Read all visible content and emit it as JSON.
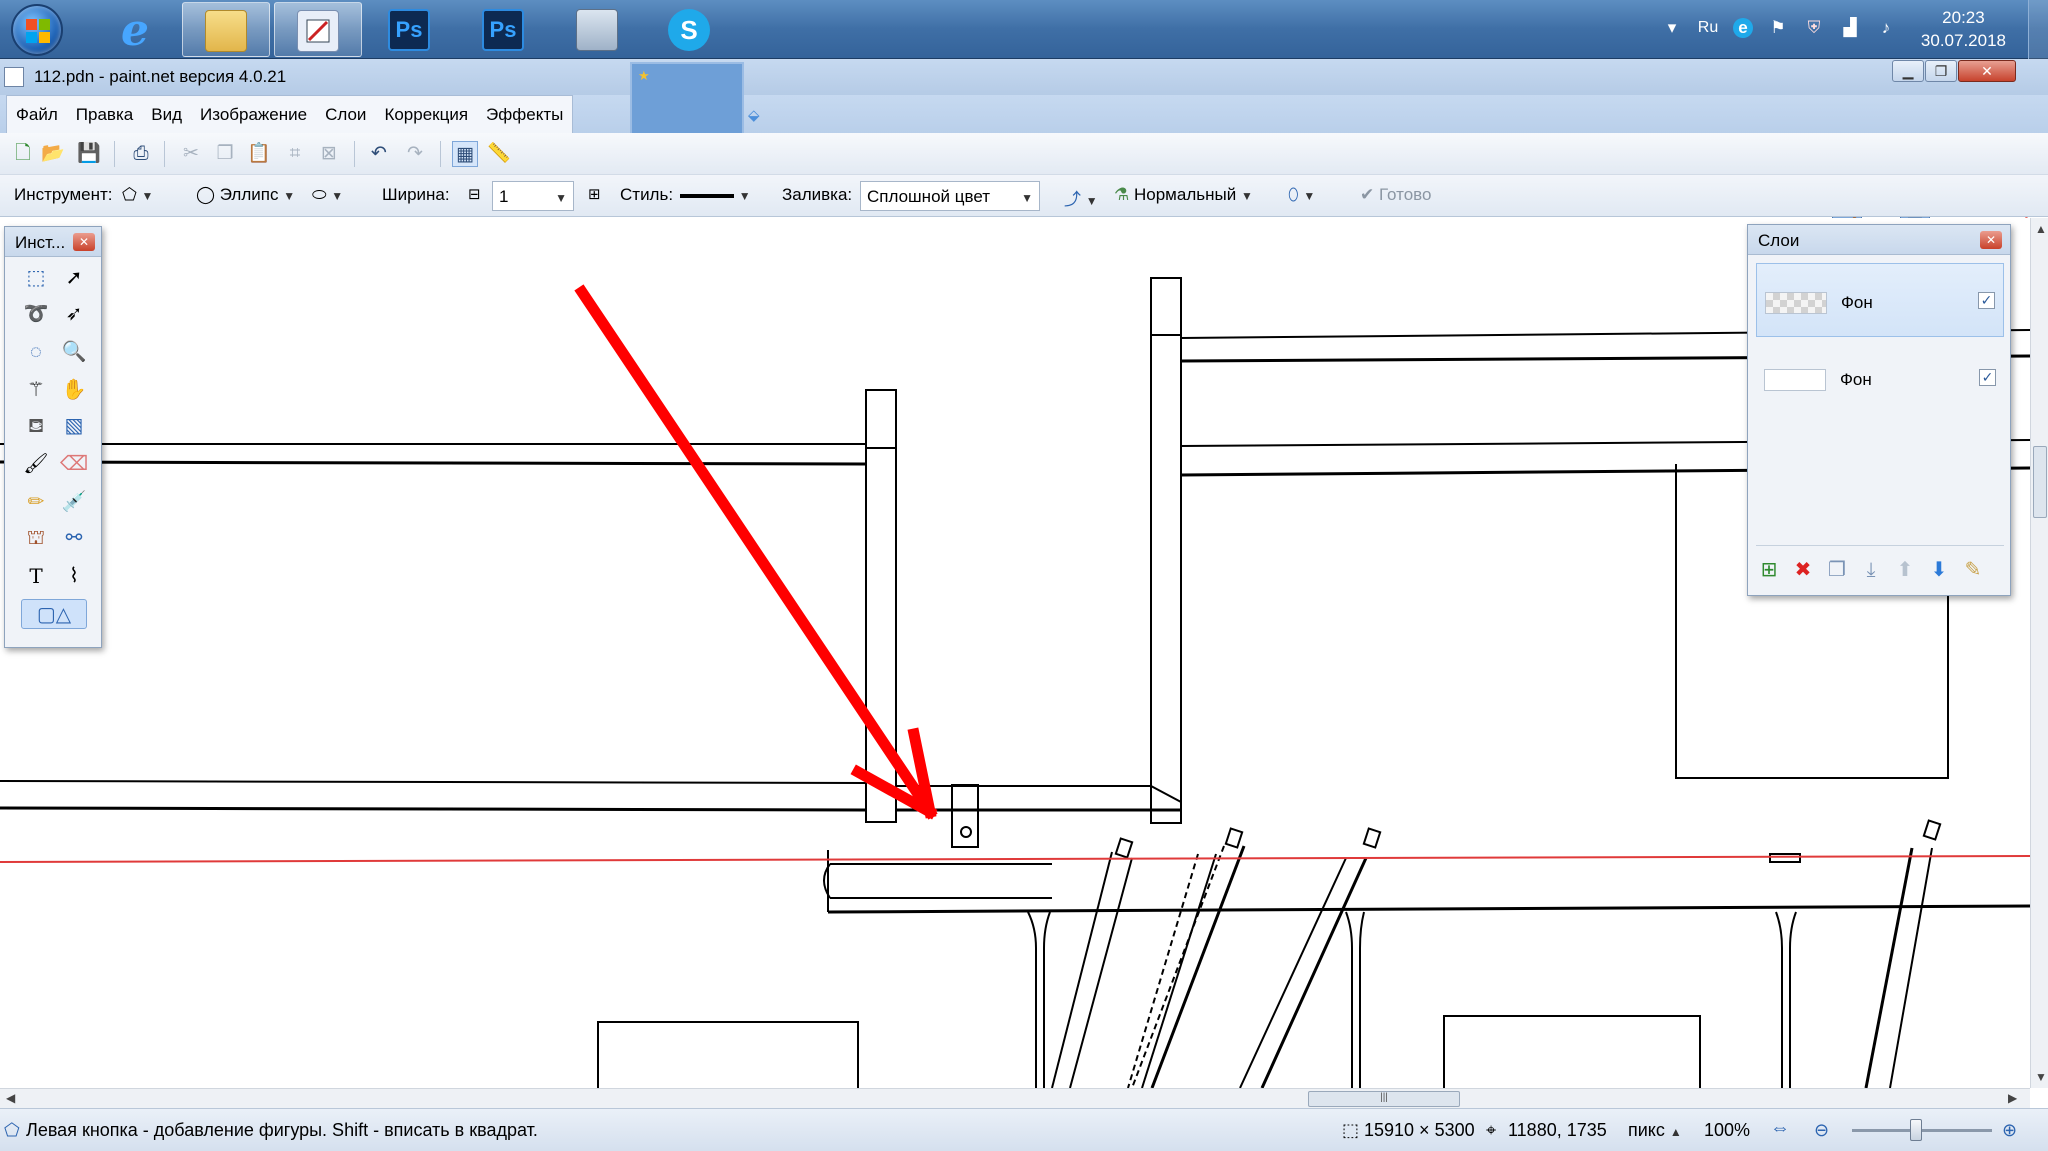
{
  "taskbar": {
    "clock_time": "20:23",
    "clock_date": "30.07.2018",
    "language": "Ru",
    "apps": [
      {
        "name": "internet-explorer",
        "label": "e"
      },
      {
        "name": "windows-explorer",
        "label": ""
      },
      {
        "name": "paint-net",
        "label": ""
      },
      {
        "name": "photoshop-1",
        "label": "Ps"
      },
      {
        "name": "photoshop-2",
        "label": "Ps"
      },
      {
        "name": "calculator",
        "label": ""
      },
      {
        "name": "skype",
        "label": "S"
      }
    ]
  },
  "window": {
    "title": "112.pdn - paint.net версия 4.0.21"
  },
  "menu": {
    "items": [
      "Файл",
      "Правка",
      "Вид",
      "Изображение",
      "Слои",
      "Коррекция",
      "Эффекты"
    ]
  },
  "toolbar": {
    "tool_label": "Инструмент:",
    "shape_label": "Эллипс",
    "width_label": "Ширина:",
    "width_value": "1",
    "style_label": "Стиль:",
    "fill_label": "Заливка:",
    "fill_value": "Сплошной цвет",
    "blend_value": "Нормальный",
    "done_label": "Готово"
  },
  "tools_panel": {
    "title": "Инст..."
  },
  "layers_panel": {
    "title": "Слои",
    "layers": [
      {
        "name": "Фон",
        "visible": true,
        "selected": true
      },
      {
        "name": "Фон",
        "visible": true,
        "selected": false
      }
    ]
  },
  "statusbar": {
    "hint": "Левая кнопка - добавление фигуры. Shift - вписать в квадрат.",
    "image_size": "15910 × 5300",
    "cursor_pos": "11880, 1735",
    "units": "пикс",
    "zoom": "100%"
  },
  "colors": {
    "accent": "#3f6fa6",
    "arrow": "#ff0000",
    "guide_line": "#e03a3a"
  }
}
